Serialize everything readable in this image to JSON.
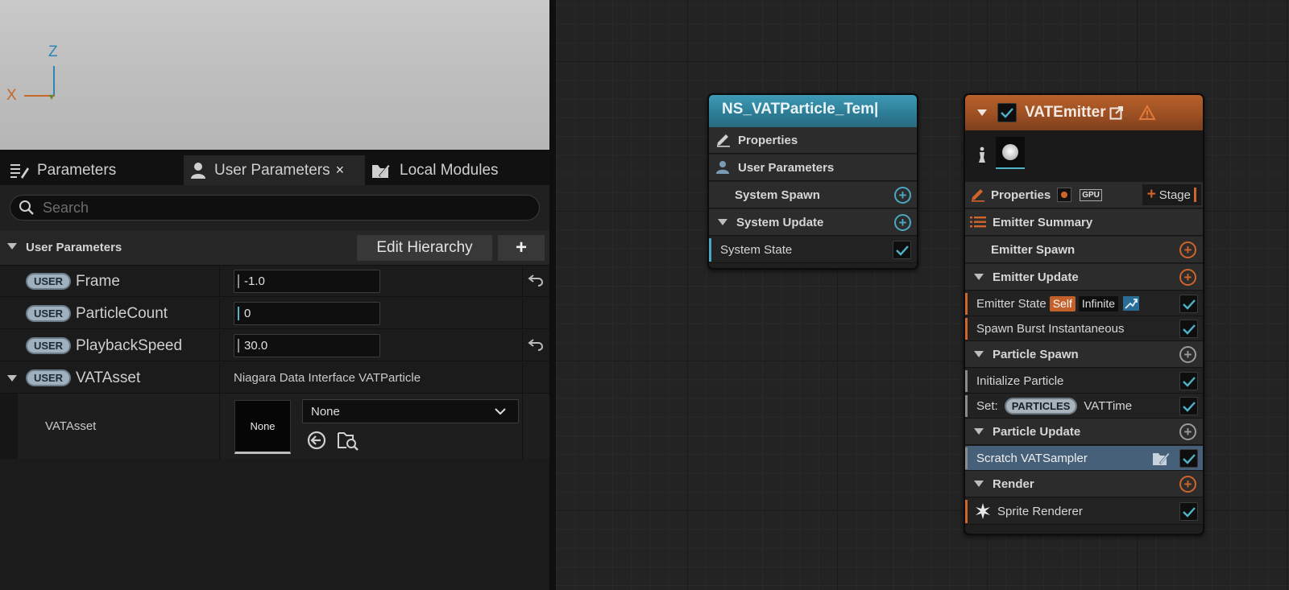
{
  "viewport": {
    "axis_z": "Z",
    "axis_x": "X"
  },
  "tabs": [
    {
      "label": "Parameters"
    },
    {
      "label": "User Parameters",
      "close": "×"
    },
    {
      "label": "Local Modules"
    }
  ],
  "search": {
    "placeholder": "Search",
    "value": ""
  },
  "user_params": {
    "header": "User Parameters",
    "edit_hierarchy": "Edit Hierarchy",
    "add": "+",
    "badge": "USER",
    "rows": [
      {
        "name": "Frame",
        "value": "-1.0"
      },
      {
        "name": "ParticleCount",
        "value": "0"
      },
      {
        "name": "PlaybackSpeed",
        "value": "30.0"
      },
      {
        "name": "VATAsset",
        "value": "Niagara Data Interface VATParticle"
      }
    ],
    "sub": {
      "label": "VATAsset",
      "thumb": "None",
      "combo": "None"
    }
  },
  "system_node": {
    "title": "NS_VATParticle_Tem|",
    "properties": "Properties",
    "user_parameters": "User Parameters",
    "system_spawn": "System Spawn",
    "system_update": "System Update",
    "system_state": "System State"
  },
  "emitter_node": {
    "title": "VATEmitter",
    "properties": "Properties",
    "gpu": "GPU",
    "stage": "Stage",
    "emitter_summary": "Emitter Summary",
    "emitter_spawn": "Emitter Spawn",
    "emitter_update": "Emitter Update",
    "emitter_state": "Emitter State",
    "tag_self": "Self",
    "tag_infinite": "Infinite",
    "spawn_burst": "Spawn Burst Instantaneous",
    "particle_spawn": "Particle Spawn",
    "initialize_particle": "Initialize Particle",
    "set_label": "Set:",
    "particles_pill": "PARTICLES",
    "vattime": "VATTime",
    "particle_update": "Particle Update",
    "scratch": "Scratch VATSampler",
    "render": "Render",
    "sprite_renderer": "Sprite Renderer"
  },
  "colors": {
    "system_accent": "#3f9ab5",
    "emitter_accent": "#b8612a",
    "plus_orange": "#d0642a",
    "plus_cyan": "#4aa8c2",
    "check": "#4fb3c9",
    "selected_row": "#46607a"
  }
}
